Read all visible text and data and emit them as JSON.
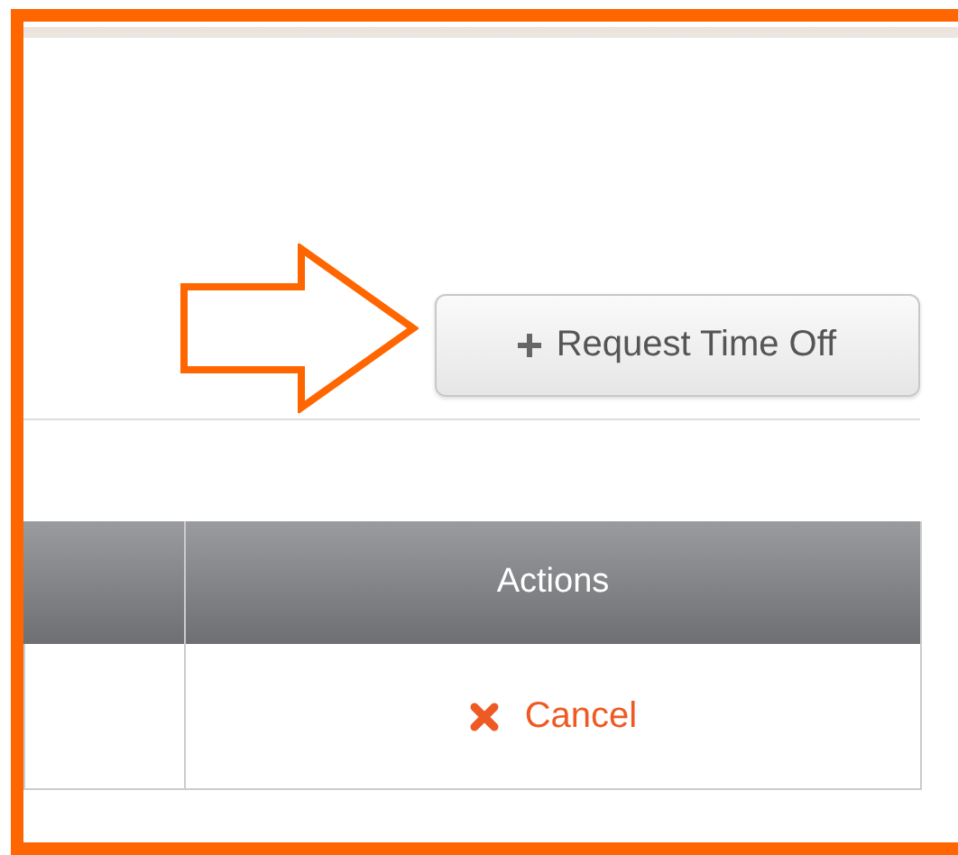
{
  "toolbar": {
    "button": {
      "label": "Request Time Off"
    }
  },
  "table": {
    "columns": [
      {
        "label": "Actions"
      }
    ],
    "rows": [
      {
        "action": {
          "label": "Cancel"
        }
      }
    ]
  }
}
